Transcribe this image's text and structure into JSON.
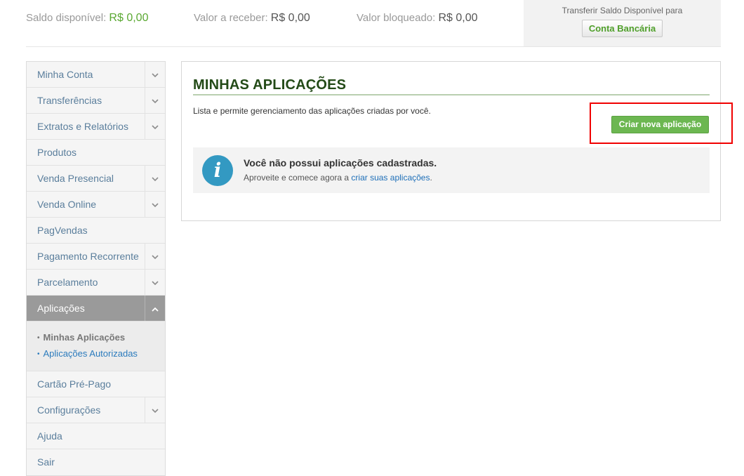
{
  "balances": {
    "available_label": "Saldo disponível:",
    "available_value": "R$ 0,00",
    "receivable_label": "Valor a receber:",
    "receivable_value": "R$ 0,00",
    "blocked_label": "Valor bloqueado:",
    "blocked_value": "R$ 0,00"
  },
  "transfer": {
    "label": "Transferir Saldo Disponível para",
    "button": "Conta Bancária"
  },
  "sidebar": {
    "items": [
      {
        "label": "Minha Conta",
        "expandable": true
      },
      {
        "label": "Transferências",
        "expandable": true
      },
      {
        "label": "Extratos e Relatórios",
        "expandable": true
      },
      {
        "label": "Produtos",
        "expandable": false
      },
      {
        "label": "Venda Presencial",
        "expandable": true
      },
      {
        "label": "Venda Online",
        "expandable": true
      },
      {
        "label": "PagVendas",
        "expandable": false
      },
      {
        "label": "Pagamento Recorrente",
        "expandable": true
      },
      {
        "label": "Parcelamento",
        "expandable": true
      },
      {
        "label": "Aplicações",
        "expandable": true,
        "active": true
      },
      {
        "label": "Cartão Pré-Pago",
        "expandable": false
      },
      {
        "label": "Configurações",
        "expandable": true
      },
      {
        "label": "Ajuda",
        "expandable": false
      },
      {
        "label": "Sair",
        "expandable": false
      }
    ],
    "submenu": [
      {
        "label": "Minhas Aplicações",
        "current": true
      },
      {
        "label": "Aplicações Autorizadas",
        "current": false
      }
    ]
  },
  "main": {
    "title": "MINHAS APLICAÇÕES",
    "description": "Lista e permite gerenciamento das aplicações criadas por você.",
    "create_button": "Criar nova aplicação",
    "empty": {
      "title": "Você não possui aplicações cadastradas.",
      "text_before": "Aproveite e comece agora a ",
      "link": "criar suas aplicações",
      "text_after": ".",
      "icon": "info-icon"
    }
  },
  "colors": {
    "brand_green": "#6cb751",
    "link_blue": "#2b7bbd",
    "highlight_red": "#f00000",
    "info_blue": "#3399c2"
  }
}
